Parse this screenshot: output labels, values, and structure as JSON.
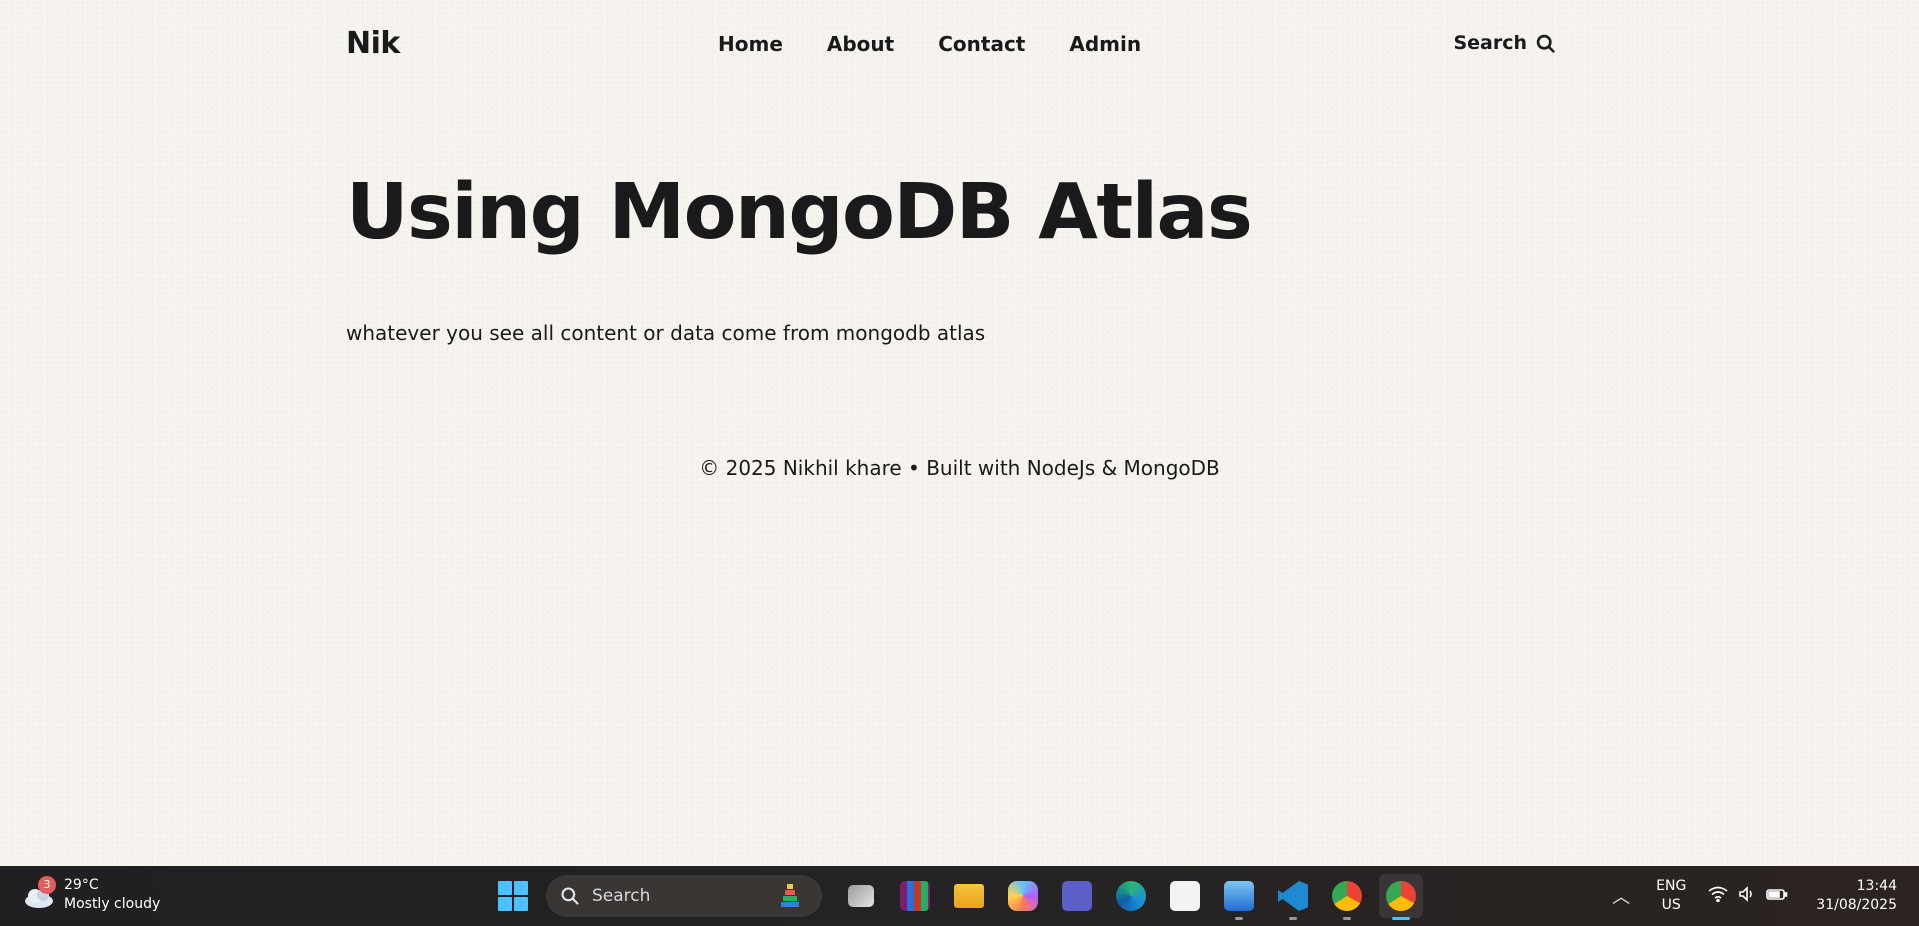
{
  "header": {
    "logo": "Nik",
    "nav": [
      "Home",
      "About",
      "Contact",
      "Admin"
    ],
    "search_label": "Search"
  },
  "hero": {
    "title": "Using MongoDB Atlas",
    "description": "whatever you see all content or data come from mongodb atlas"
  },
  "footer": {
    "text": "© 2025 Nikhil khare • Built with NodeJs & MongoDB"
  },
  "taskbar": {
    "weather": {
      "badge": "3",
      "temp": "29°C",
      "condition": "Mostly cloudy"
    },
    "search_placeholder": "Search",
    "apps": [
      "task-view",
      "winrar",
      "file-explorer",
      "copilot",
      "teams",
      "edge",
      "microsoft-store",
      "photos",
      "vscode",
      "chrome",
      "chrome-profile"
    ],
    "lang": {
      "line1": "ENG",
      "line2": "US"
    },
    "clock": {
      "time": "13:44",
      "date": "31/08/2025"
    }
  }
}
